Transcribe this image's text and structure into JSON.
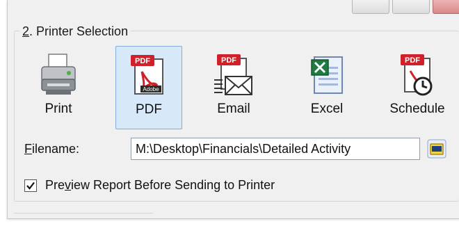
{
  "section": {
    "number": "2",
    "title_rest": ". Printer Selection"
  },
  "printer_options": [
    {
      "label": "Print",
      "icon": "printer-icon",
      "selected": false
    },
    {
      "label": "PDF",
      "icon": "pdf-icon",
      "selected": true
    },
    {
      "label": "Email",
      "icon": "email-icon",
      "selected": false
    },
    {
      "label": "Excel",
      "icon": "excel-icon",
      "selected": false
    },
    {
      "label": "Schedule",
      "icon": "schedule-icon",
      "selected": false
    }
  ],
  "filename": {
    "label_accel": "F",
    "label_rest": "ilename:",
    "value": "M:\\Desktop\\Financials\\Detailed Activity",
    "browse_icon": "folder-browse-icon"
  },
  "preview": {
    "checked": true,
    "label_before": "Pre",
    "label_accel": "v",
    "label_after": "iew Report Before Sending to Printer"
  },
  "colors": {
    "selected_bg": "#d7e8f8",
    "selected_border": "#84acdd",
    "pdf_red": "#d0202a"
  }
}
